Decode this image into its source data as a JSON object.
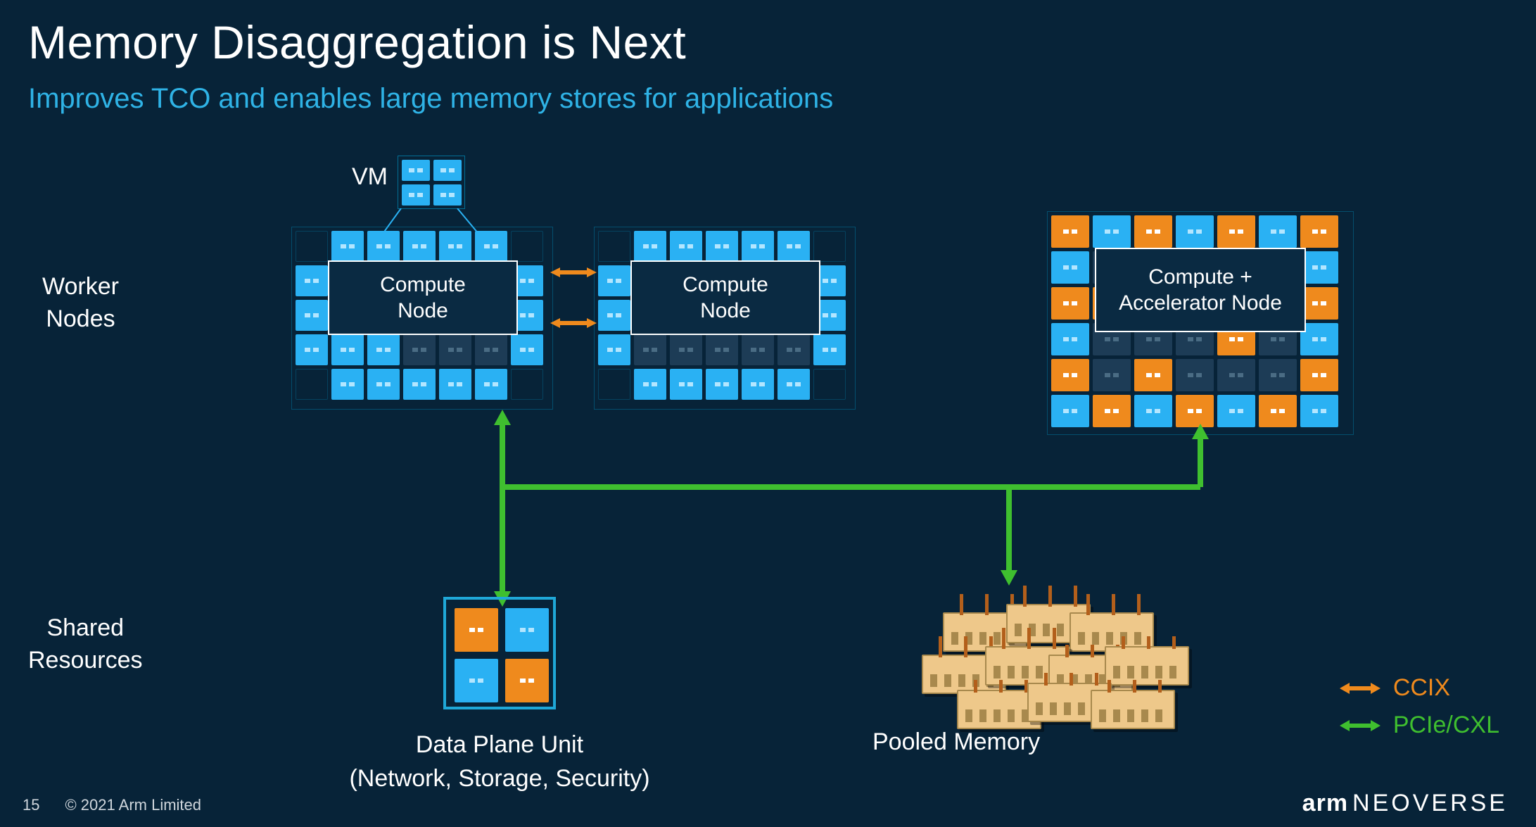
{
  "title": "Memory Disaggregation is Next",
  "subtitle": "Improves TCO and enables large memory stores for applications",
  "rowLabels": {
    "worker": "Worker\nNodes",
    "shared": "Shared\nResources"
  },
  "vmLabel": "VM",
  "nodes": {
    "compute1": "Compute\nNode",
    "compute2": "Compute\nNode",
    "accel": "Compute + Accelerator Node"
  },
  "dpu": {
    "line1": "Data Plane Unit",
    "line2": "(Network, Storage, Security)"
  },
  "pooledMemory": "Pooled Memory",
  "legend": {
    "ccix": "CCIX",
    "pcie": "PCIe/CXL"
  },
  "footer": {
    "page": "15",
    "copyright": "© 2021 Arm Limited",
    "brand_arm": "arm",
    "brand_neo": "NEOVERSE"
  },
  "colors": {
    "bg": "#072338",
    "accent": "#2fb3e6",
    "ccix": "#ef8a1d",
    "pcie": "#3fbf2f"
  }
}
